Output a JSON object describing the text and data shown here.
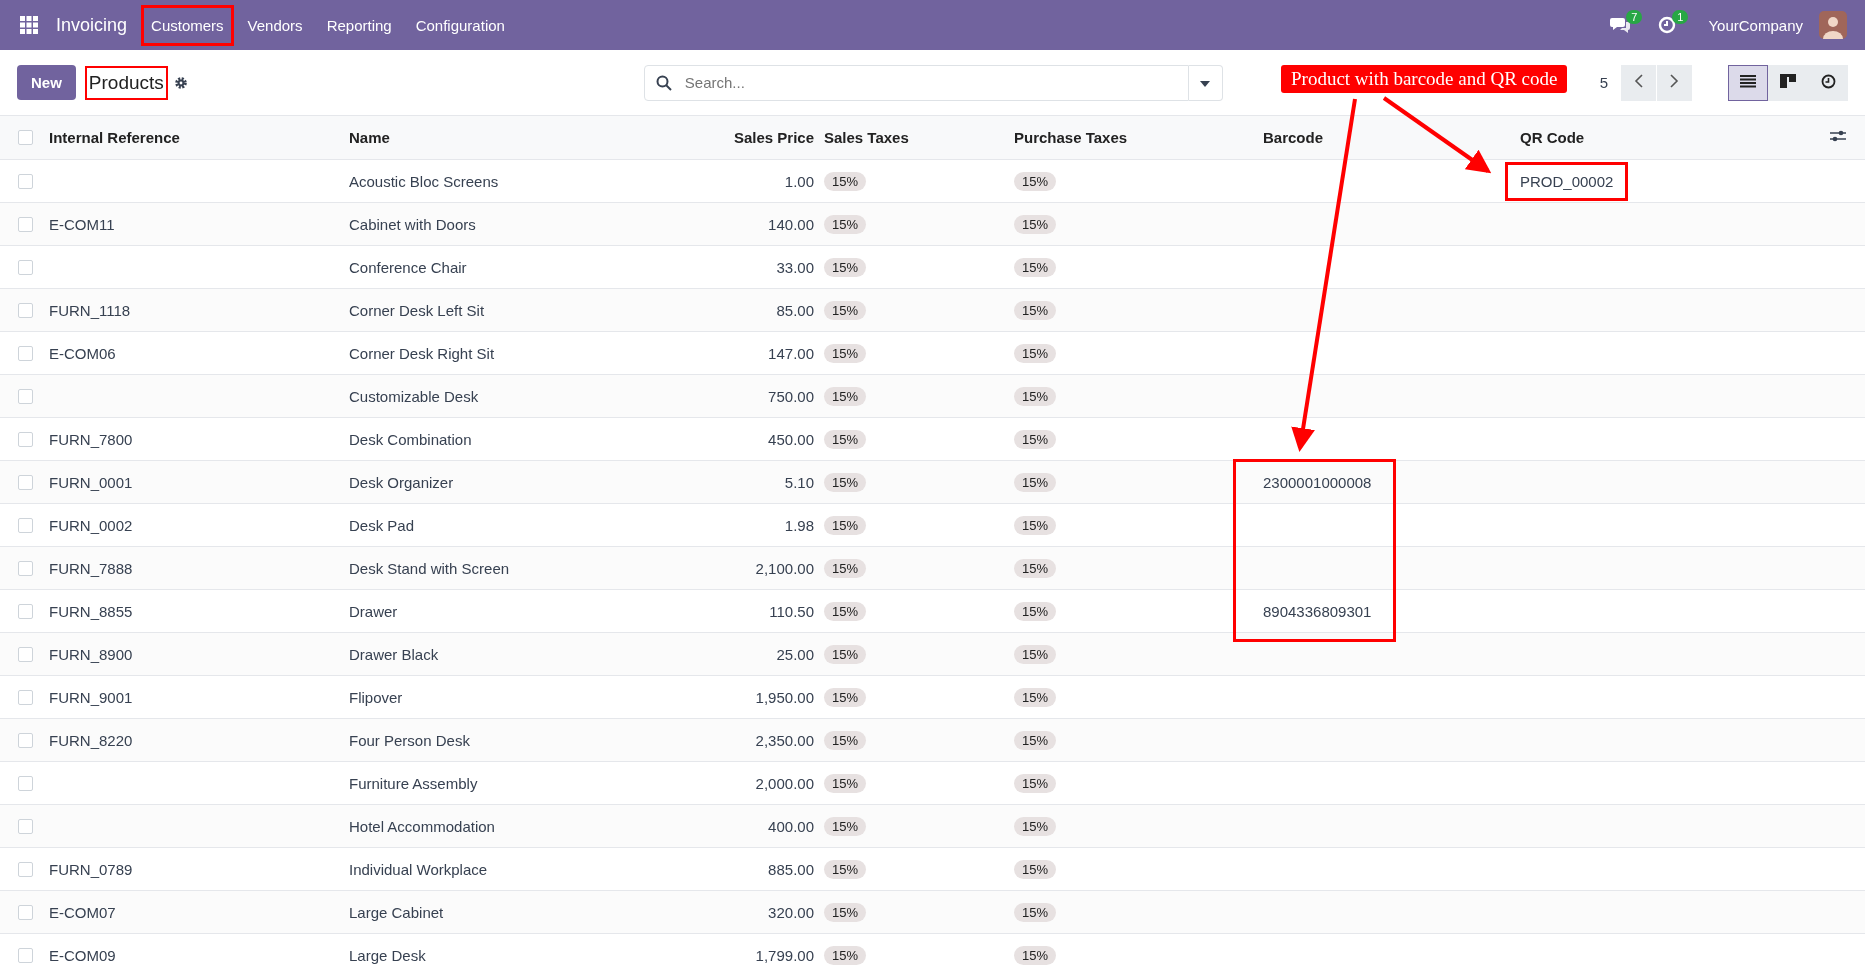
{
  "navbar": {
    "app_name": "Invoicing",
    "menu": [
      {
        "label": "Customers",
        "highlighted": true
      },
      {
        "label": "Vendors",
        "highlighted": false
      },
      {
        "label": "Reporting",
        "highlighted": false
      },
      {
        "label": "Configuration",
        "highlighted": false
      }
    ],
    "messages_count": "7",
    "activities_count": "1",
    "company": "YourCompany"
  },
  "control_panel": {
    "new_button": "New",
    "title": "Products",
    "title_highlighted": true,
    "search": {
      "placeholder": "Search..."
    },
    "pager": "5",
    "views": [
      {
        "kind": "list",
        "selected": true
      },
      {
        "kind": "kanban",
        "selected": false
      },
      {
        "kind": "activity",
        "selected": false
      }
    ]
  },
  "annotation": {
    "label": "Product with barcode and QR code"
  },
  "table": {
    "all_checked": false,
    "columns": [
      "Internal Reference",
      "Name",
      "Sales Price",
      "Sales Taxes",
      "Purchase Taxes",
      "Barcode",
      "QR Code"
    ],
    "rows": [
      {
        "checked": false,
        "ref": "",
        "name": "Acoustic Bloc Screens",
        "price": "1.00",
        "sales_tax": "15%",
        "purchase_tax": "15%",
        "barcode": "",
        "qr": "PROD_00002",
        "qr_highlighted": true
      },
      {
        "checked": false,
        "ref": "E-COM11",
        "name": "Cabinet with Doors",
        "price": "140.00",
        "sales_tax": "15%",
        "purchase_tax": "15%",
        "barcode": "",
        "qr": ""
      },
      {
        "checked": false,
        "ref": "",
        "name": "Conference Chair",
        "price": "33.00",
        "sales_tax": "15%",
        "purchase_tax": "15%",
        "barcode": "",
        "qr": ""
      },
      {
        "checked": false,
        "ref": "FURN_1118",
        "name": "Corner Desk Left Sit",
        "price": "85.00",
        "sales_tax": "15%",
        "purchase_tax": "15%",
        "barcode": "",
        "qr": ""
      },
      {
        "checked": false,
        "ref": "E-COM06",
        "name": "Corner Desk Right Sit",
        "price": "147.00",
        "sales_tax": "15%",
        "purchase_tax": "15%",
        "barcode": "",
        "qr": ""
      },
      {
        "checked": false,
        "ref": "",
        "name": "Customizable Desk",
        "price": "750.00",
        "sales_tax": "15%",
        "purchase_tax": "15%",
        "barcode": "",
        "qr": ""
      },
      {
        "checked": false,
        "ref": "FURN_7800",
        "name": "Desk Combination",
        "price": "450.00",
        "sales_tax": "15%",
        "purchase_tax": "15%",
        "barcode": "",
        "qr": ""
      },
      {
        "checked": false,
        "ref": "FURN_0001",
        "name": "Desk Organizer",
        "price": "5.10",
        "sales_tax": "15%",
        "purchase_tax": "15%",
        "barcode": "2300001000008",
        "qr": ""
      },
      {
        "checked": false,
        "ref": "FURN_0002",
        "name": "Desk Pad",
        "price": "1.98",
        "sales_tax": "15%",
        "purchase_tax": "15%",
        "barcode": "",
        "qr": ""
      },
      {
        "checked": false,
        "ref": "FURN_7888",
        "name": "Desk Stand with Screen",
        "price": "2,100.00",
        "sales_tax": "15%",
        "purchase_tax": "15%",
        "barcode": "",
        "qr": ""
      },
      {
        "checked": false,
        "ref": "FURN_8855",
        "name": "Drawer",
        "price": "110.50",
        "sales_tax": "15%",
        "purchase_tax": "15%",
        "barcode": "8904336809301",
        "qr": ""
      },
      {
        "checked": false,
        "ref": "FURN_8900",
        "name": "Drawer Black",
        "price": "25.00",
        "sales_tax": "15%",
        "purchase_tax": "15%",
        "barcode": "",
        "qr": ""
      },
      {
        "checked": false,
        "ref": "FURN_9001",
        "name": "Flipover",
        "price": "1,950.00",
        "sales_tax": "15%",
        "purchase_tax": "15%",
        "barcode": "",
        "qr": ""
      },
      {
        "checked": false,
        "ref": "FURN_8220",
        "name": "Four Person Desk",
        "price": "2,350.00",
        "sales_tax": "15%",
        "purchase_tax": "15%",
        "barcode": "",
        "qr": ""
      },
      {
        "checked": false,
        "ref": "",
        "name": "Furniture Assembly",
        "price": "2,000.00",
        "sales_tax": "15%",
        "purchase_tax": "15%",
        "barcode": "",
        "qr": ""
      },
      {
        "checked": false,
        "ref": "",
        "name": "Hotel Accommodation",
        "price": "400.00",
        "sales_tax": "15%",
        "purchase_tax": "15%",
        "barcode": "",
        "qr": ""
      },
      {
        "checked": false,
        "ref": "FURN_0789",
        "name": "Individual Workplace",
        "price": "885.00",
        "sales_tax": "15%",
        "purchase_tax": "15%",
        "barcode": "",
        "qr": ""
      },
      {
        "checked": false,
        "ref": "E-COM07",
        "name": "Large Cabinet",
        "price": "320.00",
        "sales_tax": "15%",
        "purchase_tax": "15%",
        "barcode": "",
        "qr": ""
      },
      {
        "checked": false,
        "ref": "E-COM09",
        "name": "Large Desk",
        "price": "1,799.00",
        "sales_tax": "15%",
        "purchase_tax": "15%",
        "barcode": "",
        "qr": ""
      }
    ]
  }
}
